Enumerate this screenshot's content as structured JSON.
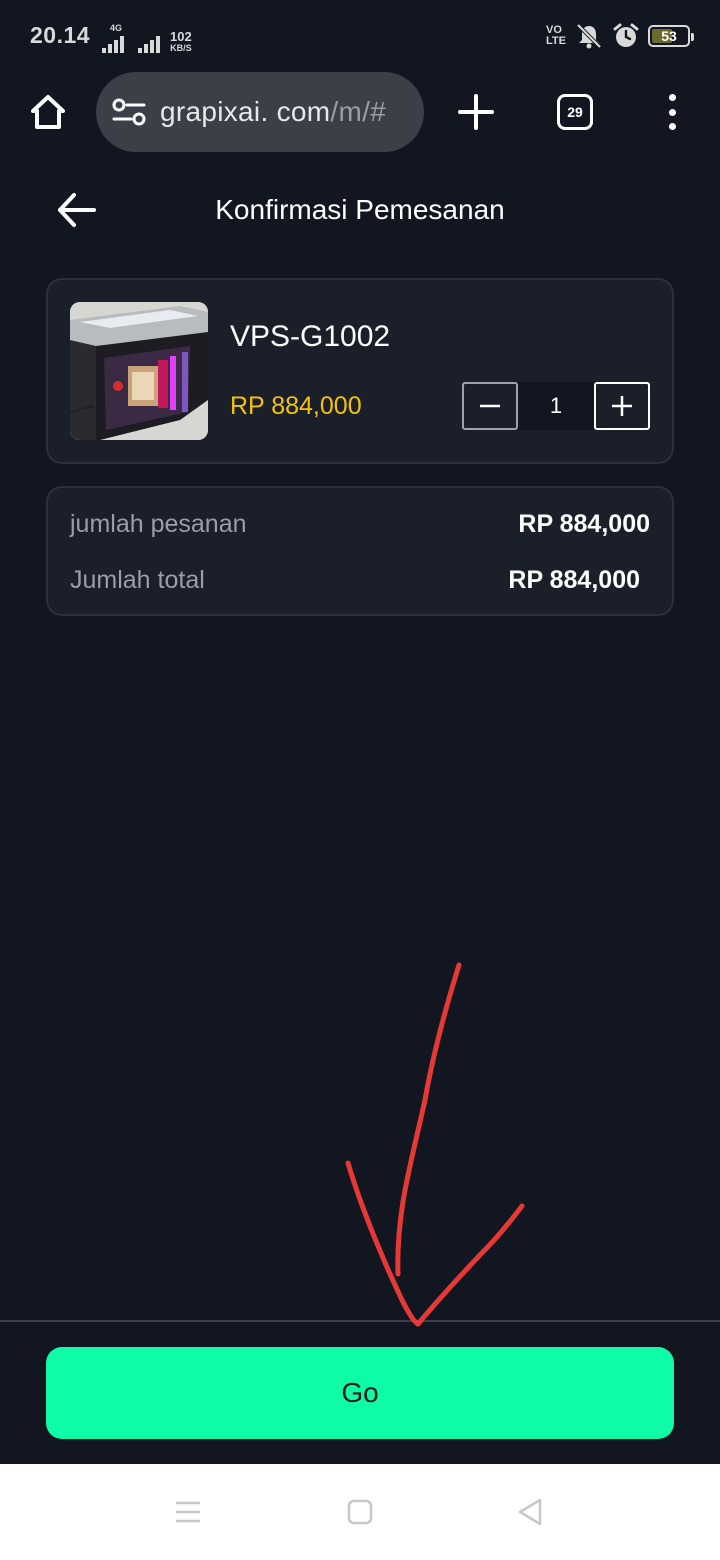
{
  "status_bar": {
    "time": "20.14",
    "network_type": "4G",
    "speed_value": "102",
    "speed_unit": "KB/S",
    "volte_line1": "VO",
    "volte_line2": "LTE",
    "battery_level": "53",
    "battery_fraction": 0.53
  },
  "browser": {
    "url_main": "grapixai. com",
    "url_path": "/m/#",
    "tab_count": "29",
    "icons": [
      "home-icon",
      "site-settings-icon",
      "new-tab-icon",
      "tab-switcher-icon",
      "overflow-menu-icon"
    ]
  },
  "header": {
    "title": "Konfirmasi Pemesanan",
    "back_icon": "arrow-left-icon"
  },
  "product": {
    "name": "VPS-G1002",
    "price": "RP 884,000",
    "quantity": "1",
    "image": "pc-case-photo"
  },
  "summary": {
    "order_amount_label": "jumlah pesanan",
    "order_amount_value": "RP 884,000",
    "total_label": "Jumlah total",
    "total_value": "RP 884,000"
  },
  "action": {
    "go_label": "Go"
  },
  "nav_bar": {
    "icons": [
      "recents-icon",
      "home-square-icon",
      "back-triangle-icon"
    ]
  },
  "colors": {
    "background": "#121621",
    "card": "#1b1f2a",
    "price": "#f5c400",
    "go_button": "#0dfca5",
    "annotation": "#e53935"
  }
}
